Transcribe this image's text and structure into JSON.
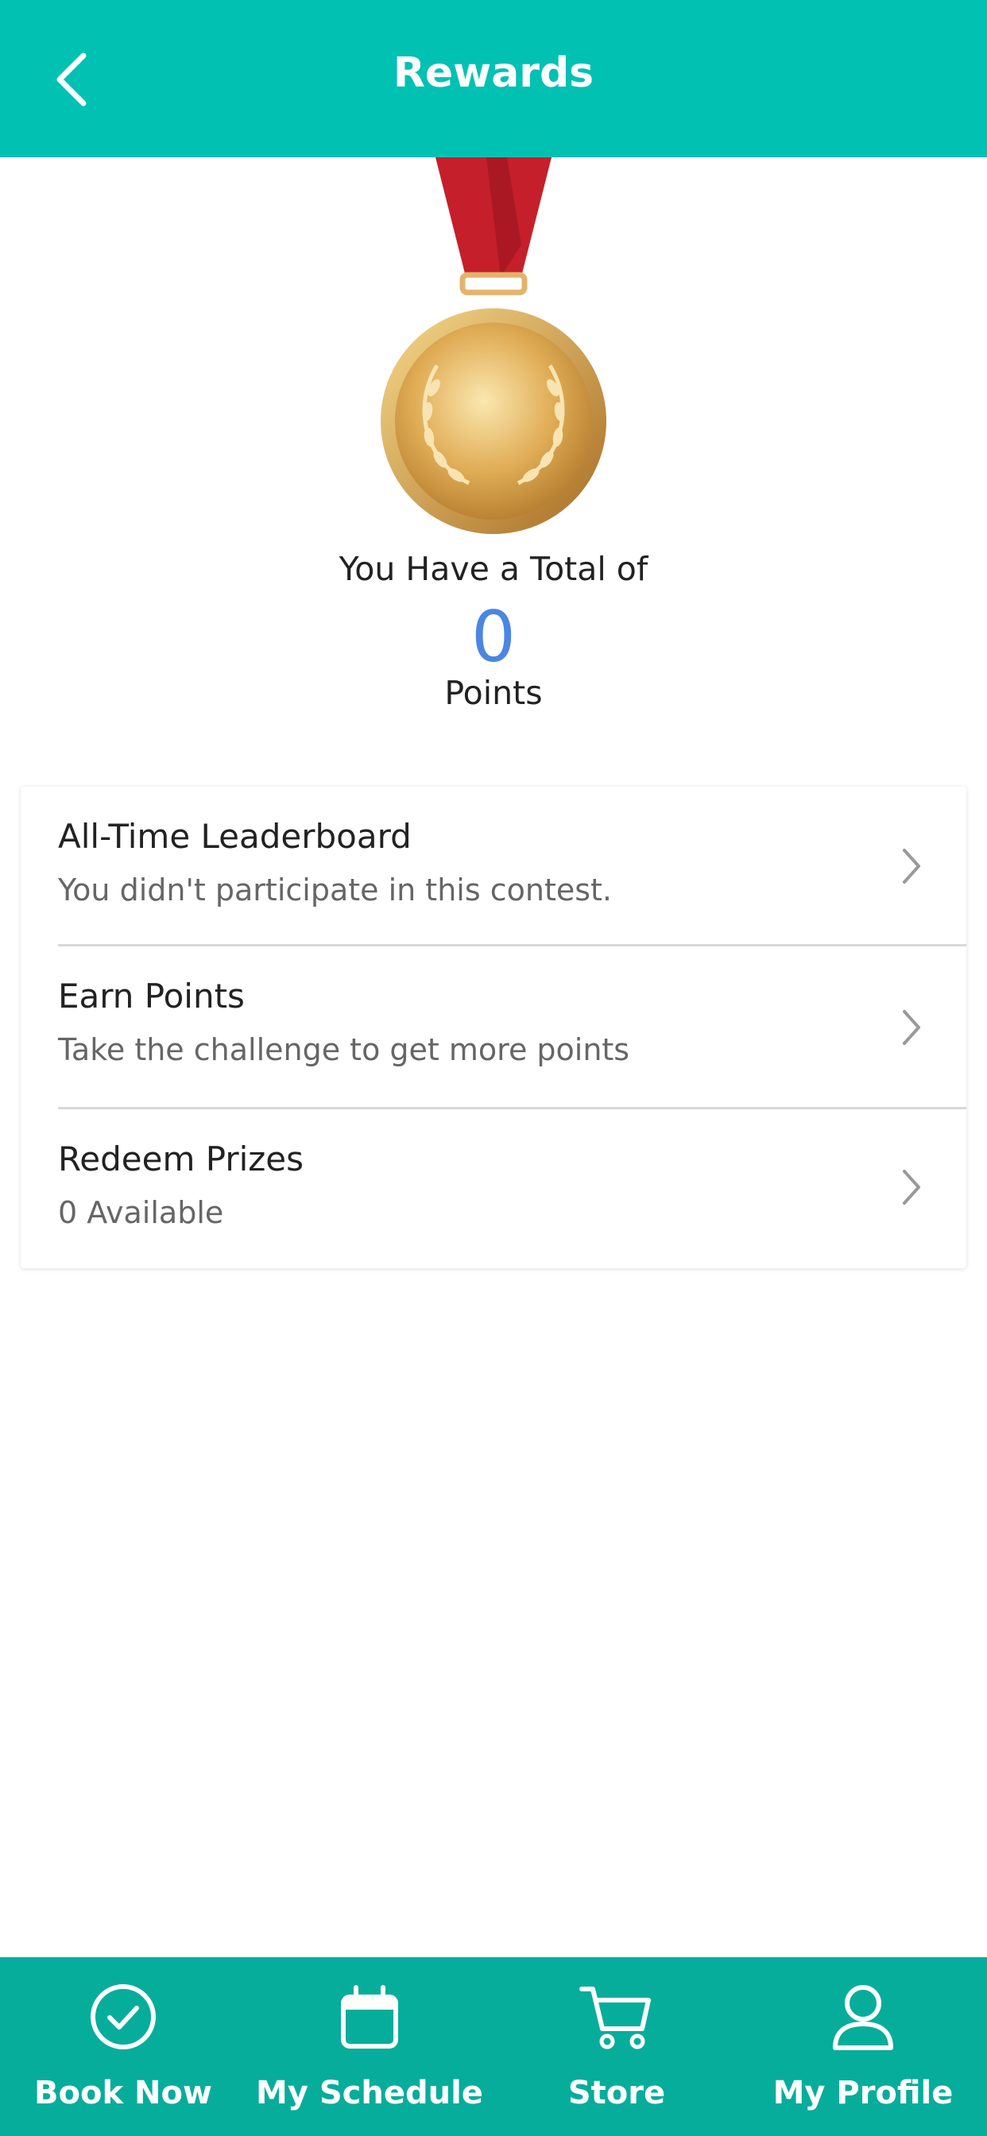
{
  "header": {
    "title": "Rewards",
    "back_icon": "chevron-left-icon",
    "background": "#00c1b2"
  },
  "summary": {
    "total_label": "You Have a Total of",
    "points_value": "0",
    "points_label": "Points",
    "medal_icon": "gold-medal-icon",
    "points_color": "#4a86e2"
  },
  "menu": {
    "items": [
      {
        "title": "All-Time Leaderboard",
        "subtitle": "You didn't participate in this contest."
      },
      {
        "title": "Earn Points",
        "subtitle": "Take the challenge to get more points"
      },
      {
        "title": "Redeem Prizes",
        "subtitle": "0 Available"
      }
    ]
  },
  "tabbar": {
    "background": "#06ad9b",
    "tabs": [
      {
        "label": "Book Now",
        "icon": "check-circle-icon"
      },
      {
        "label": "My Schedule",
        "icon": "calendar-icon"
      },
      {
        "label": "Store",
        "icon": "cart-icon"
      },
      {
        "label": "My Profile",
        "icon": "user-icon"
      }
    ]
  }
}
